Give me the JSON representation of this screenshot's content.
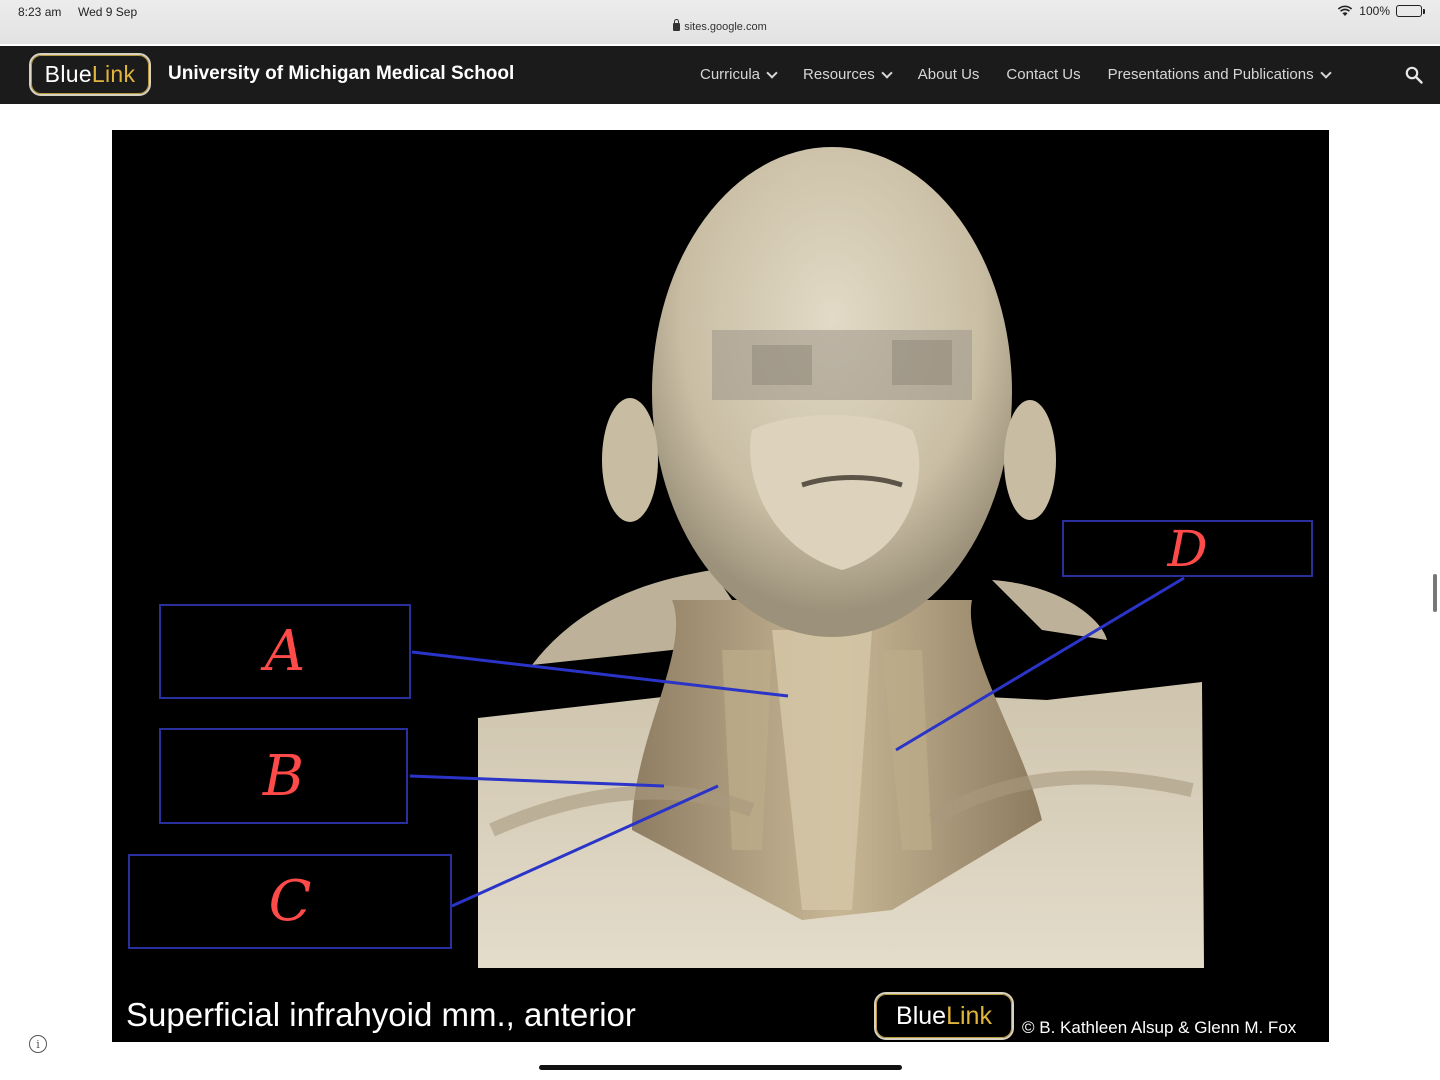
{
  "status": {
    "time": "8:23 am",
    "date": "Wed 9 Sep",
    "battery": "100%",
    "url": "sites.google.com"
  },
  "nav": {
    "logo_blue": "Blue",
    "logo_link": "Link",
    "site_title": "University of Michigan Medical School",
    "items": [
      {
        "label": "Curricula",
        "dropdown": true
      },
      {
        "label": "Resources",
        "dropdown": true
      },
      {
        "label": "About Us",
        "dropdown": false
      },
      {
        "label": "Contact Us",
        "dropdown": false
      },
      {
        "label": "Presentations and Publications",
        "dropdown": true
      }
    ]
  },
  "slide": {
    "labels": {
      "a": "A",
      "b": "B",
      "c": "C",
      "d": "D"
    },
    "caption": "Superficial infrahyoid mm., anterior",
    "logo_blue": "Blue",
    "logo_link": "Link",
    "copyright": "© B. Kathleen Alsup & Glenn M. Fox"
  },
  "colors": {
    "nav_bg": "#1b1b1b",
    "logo_gold": "#e0b53a",
    "label_box_border": "#2a2f9e",
    "label_letter": "#ff4a4a",
    "pointer_line": "#2a34c8"
  }
}
